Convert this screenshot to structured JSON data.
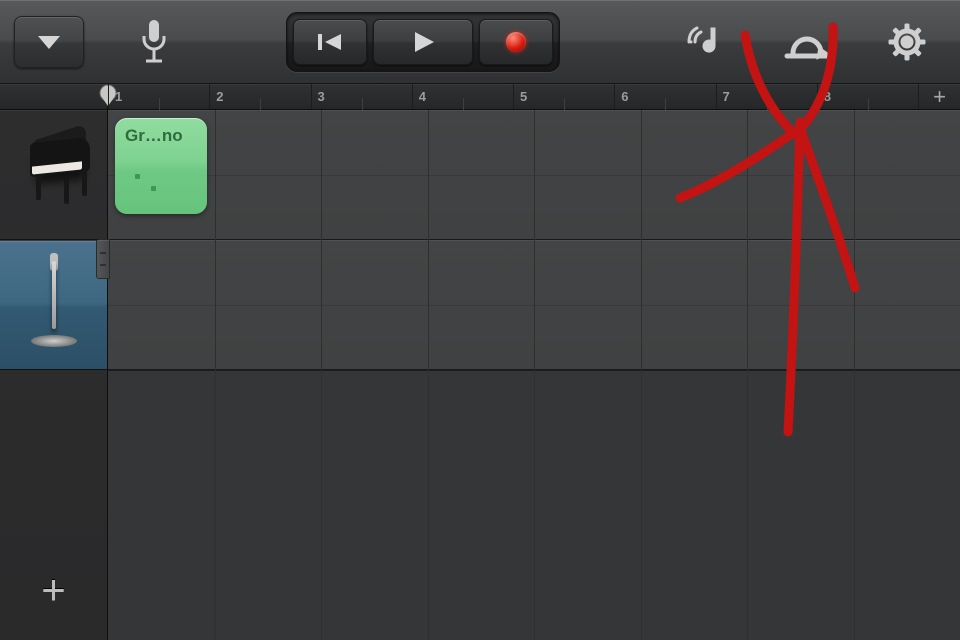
{
  "ruler": {
    "bars": [
      "1",
      "2",
      "3",
      "4",
      "5",
      "6",
      "7",
      "8"
    ],
    "add_bar_symbol": "+"
  },
  "tracks": [
    {
      "id": "piano",
      "selected": false,
      "icon": "grand-piano-icon"
    },
    {
      "id": "mic",
      "selected": true,
      "icon": "mic-stand-icon"
    }
  ],
  "regions": [
    {
      "track": 0,
      "bar_start": 1,
      "label": "Gr…no"
    }
  ],
  "sidebar": {
    "add_track_symbol": "+"
  },
  "annotation": {
    "kind": "hand-drawn-arrow",
    "points_to_icon": "loop-icon",
    "color": "#c31313"
  }
}
